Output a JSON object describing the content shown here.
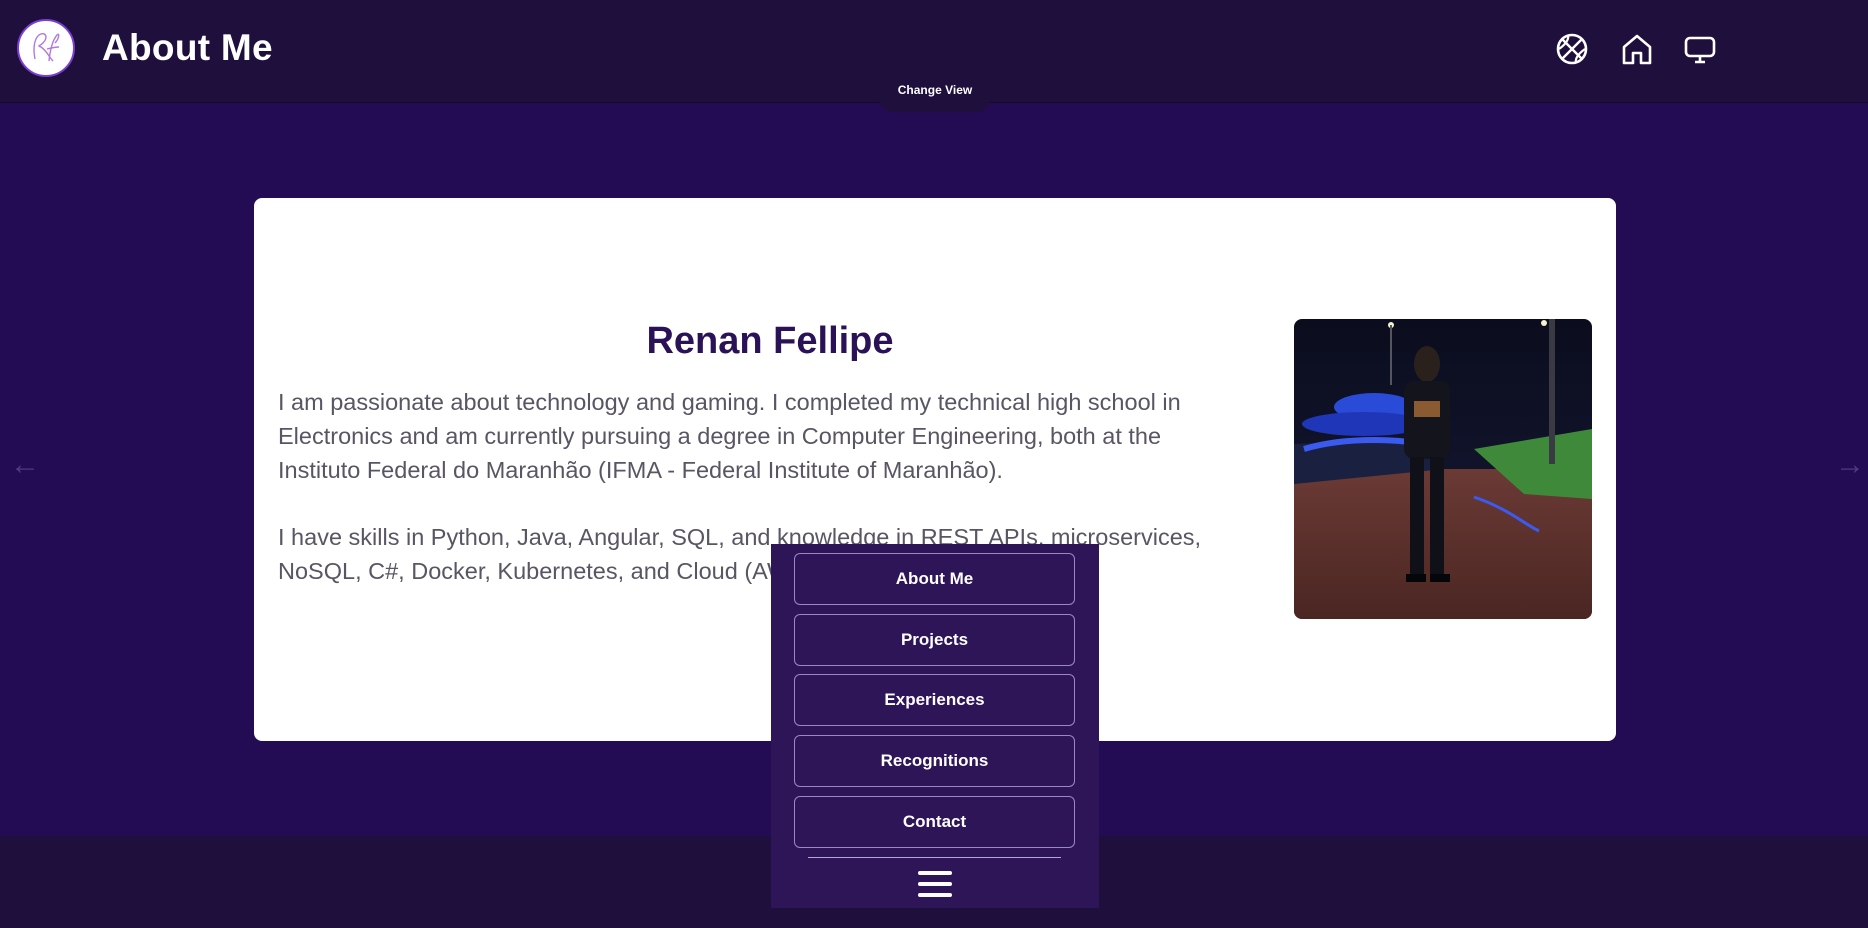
{
  "header": {
    "title": "About Me",
    "change_view_label": "Change View",
    "icons": [
      "basketball-icon",
      "home-icon",
      "monitor-icon"
    ]
  },
  "profile": {
    "name": "Renan Fellipe",
    "bio_paragraph_1": "I am passionate about technology and gaming. I completed my technical high school in Electronics and am currently pursuing a degree in Computer Engineering, both at the Instituto Federal do Maranhão (IFMA - Federal Institute of Maranhão).",
    "bio_paragraph_2": "I have skills in Python, Java, Angular, SQL, and knowledge in REST APIs, microservices, NoSQL, C#, Docker, Kubernetes, and Cloud (AWS)."
  },
  "carousel": {
    "prev_arrow": "←",
    "next_arrow": "→"
  },
  "menu": {
    "items": [
      {
        "label": "About Me"
      },
      {
        "label": "Projects"
      },
      {
        "label": "Experiences"
      },
      {
        "label": "Recognitions"
      },
      {
        "label": "Contact"
      }
    ],
    "toggle_icon": "hamburger-icon"
  },
  "colors": {
    "background": "#240c54",
    "header": "#1f0f3d",
    "menu_panel": "#2d1558",
    "name_text": "#2b1257"
  }
}
